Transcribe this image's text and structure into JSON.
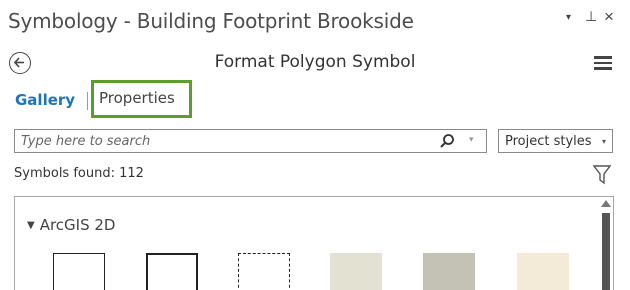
{
  "window": {
    "title": "Symbology - Building Footprint Brookside",
    "dropdown_glyph": "▾",
    "pin_glyph": "⊥",
    "close_glyph": "×"
  },
  "nav": {
    "pane_title": "Format Polygon Symbol",
    "back_icon": "back-arrow-circle-icon",
    "menu_icon": "hamburger-menu-icon"
  },
  "tabs": [
    {
      "label": "Gallery",
      "active": true
    },
    {
      "label": "Properties",
      "active": false,
      "highlighted": true
    }
  ],
  "search": {
    "placeholder": "Type here to search",
    "value": "",
    "icon": "search-icon",
    "dropdown_glyph": "▾"
  },
  "styles_select": {
    "selected": "Project styles",
    "dropdown_glyph": "▾"
  },
  "results": {
    "found_text": "Symbols found: 112",
    "filter_icon": "filter-icon"
  },
  "gallery": {
    "group_label": "ArcGIS 2D",
    "group_chevron": "❯",
    "symbols": [
      {
        "style": "outline-thin",
        "fill": "#ffffff"
      },
      {
        "style": "outline-thick",
        "fill": "#ffffff"
      },
      {
        "style": "outline-dashed",
        "fill": "#ffffff"
      },
      {
        "style": "solid",
        "fill": "#e3e1d1"
      },
      {
        "style": "solid",
        "fill": "#c4c1b5"
      },
      {
        "style": "solid",
        "fill": "#f3ebd7"
      }
    ]
  },
  "colors": {
    "accent_blue": "#1e73be",
    "highlight_green": "#5a9e2f"
  }
}
